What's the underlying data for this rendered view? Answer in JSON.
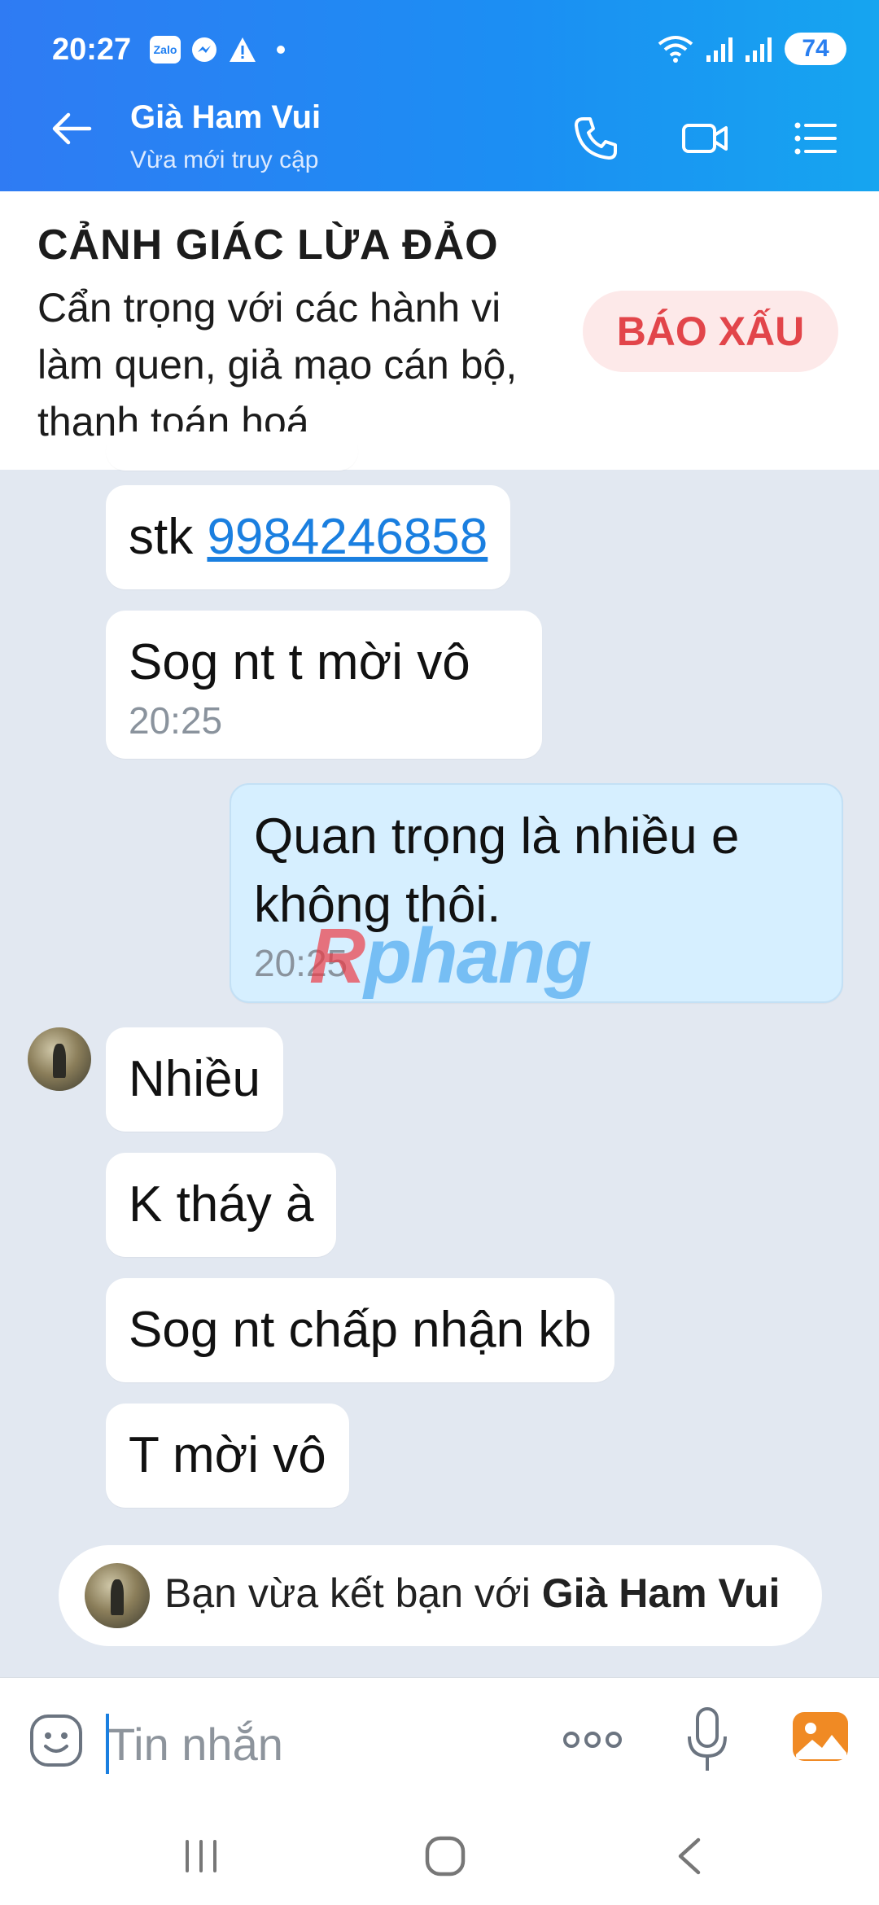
{
  "status": {
    "time": "20:27",
    "battery": "74",
    "badge_app": "Zalo"
  },
  "header": {
    "contact_name": "Già Ham Vui",
    "contact_status": "Vừa mới truy cập"
  },
  "warning": {
    "title": "CẢNH GIÁC LỪA ĐẢO",
    "body": "Cẩn trọng với các hành vi làm quen, giả mạo cán bộ, thanh toán hoá",
    "report_label": "BÁO XẤU"
  },
  "messages": [
    {
      "sender": "other",
      "prefix": "stk ",
      "link": "9984246858"
    },
    {
      "sender": "other",
      "text": "Sog nt t mời vô",
      "time": "20:25"
    },
    {
      "sender": "me",
      "text": "Quan trọng là nhiều e không thôi.",
      "time": "20:25"
    },
    {
      "sender": "other",
      "text": "Nhiều"
    },
    {
      "sender": "other",
      "text": "K tháy à"
    },
    {
      "sender": "other",
      "text": "Sog nt chấp nhận kb"
    },
    {
      "sender": "other",
      "text": "T mời vô"
    }
  ],
  "system_notice": {
    "prefix": "Bạn vừa kết bạn với ",
    "name": "Già Ham Vui"
  },
  "watermark": {
    "r": "R",
    "rest": "phang"
  },
  "input": {
    "placeholder": "Tin nhắn"
  },
  "colors": {
    "header": "#1f86f3",
    "accent": "#1a7fe0",
    "report": "#e2454a",
    "chat_bg": "#e2e8f1",
    "my_bubble": "#d6efff"
  }
}
